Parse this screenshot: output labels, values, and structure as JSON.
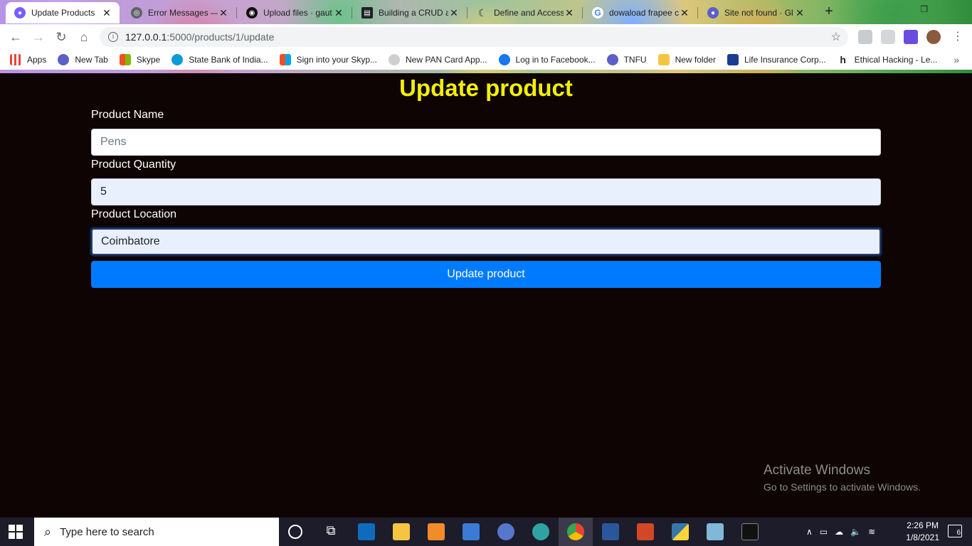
{
  "browser": {
    "tabs": [
      {
        "title": "Update Products",
        "fav_color": "#7a5cff"
      },
      {
        "title": "Error Messages —",
        "fav_color": "#5f6368"
      },
      {
        "title": "Upload files · gaut",
        "fav_color": "#111111"
      },
      {
        "title": "Building a CRUD a",
        "fav_color": "#202124"
      },
      {
        "title": "Define and Access",
        "fav_color": "#202124"
      },
      {
        "title": "dowaload frapee c",
        "fav_color": "#4285f4"
      },
      {
        "title": "Site not found · Gl",
        "fav_color": "#5b5fc7"
      }
    ],
    "url_host": "127.0.0.1",
    "url_path": ":5000/products/1/update",
    "bookmarks": [
      {
        "label": "Apps",
        "icon": "apps-grid-icon",
        "color": "#ea4335"
      },
      {
        "label": "New Tab",
        "icon": "globe-icon",
        "color": "#5b5fc7"
      },
      {
        "label": "Skype",
        "icon": "windows-logo-icon",
        "color": "#f25022"
      },
      {
        "label": "State Bank of India...",
        "icon": "sbi-icon",
        "color": "#0a9bd6"
      },
      {
        "label": "Sign into your Skyp...",
        "icon": "windows-logo-icon",
        "color": "#f25022"
      },
      {
        "label": "New PAN Card App...",
        "icon": "ie-icon",
        "color": "#8a8a8a"
      },
      {
        "label": "Log in to Facebook...",
        "icon": "facebook-icon",
        "color": "#1877f2"
      },
      {
        "label": "TNFU",
        "icon": "globe-icon",
        "color": "#5b5fc7"
      },
      {
        "label": "New folder",
        "icon": "folder-icon",
        "color": "#f5c542"
      },
      {
        "label": "Life Insurance Corp...",
        "icon": "lic-icon",
        "color": "#1a3d8f"
      },
      {
        "label": "Ethical Hacking - Le...",
        "icon": "h-icon",
        "color": "#222222"
      }
    ]
  },
  "page": {
    "title": "Update product",
    "fields": [
      {
        "label": "Product Name",
        "value": "",
        "placeholder": "Pens"
      },
      {
        "label": "Product Quantity",
        "value": "5",
        "placeholder": ""
      },
      {
        "label": "Product Location",
        "value": "Coimbatore",
        "placeholder": ""
      }
    ],
    "submit_label": "Update product"
  },
  "watermark": {
    "line1": "Activate Windows",
    "line2": "Go to Settings to activate Windows."
  },
  "taskbar": {
    "search_placeholder": "Type here to search",
    "time": "2:26 PM",
    "date": "1/8/2021",
    "notification_count": "6"
  }
}
